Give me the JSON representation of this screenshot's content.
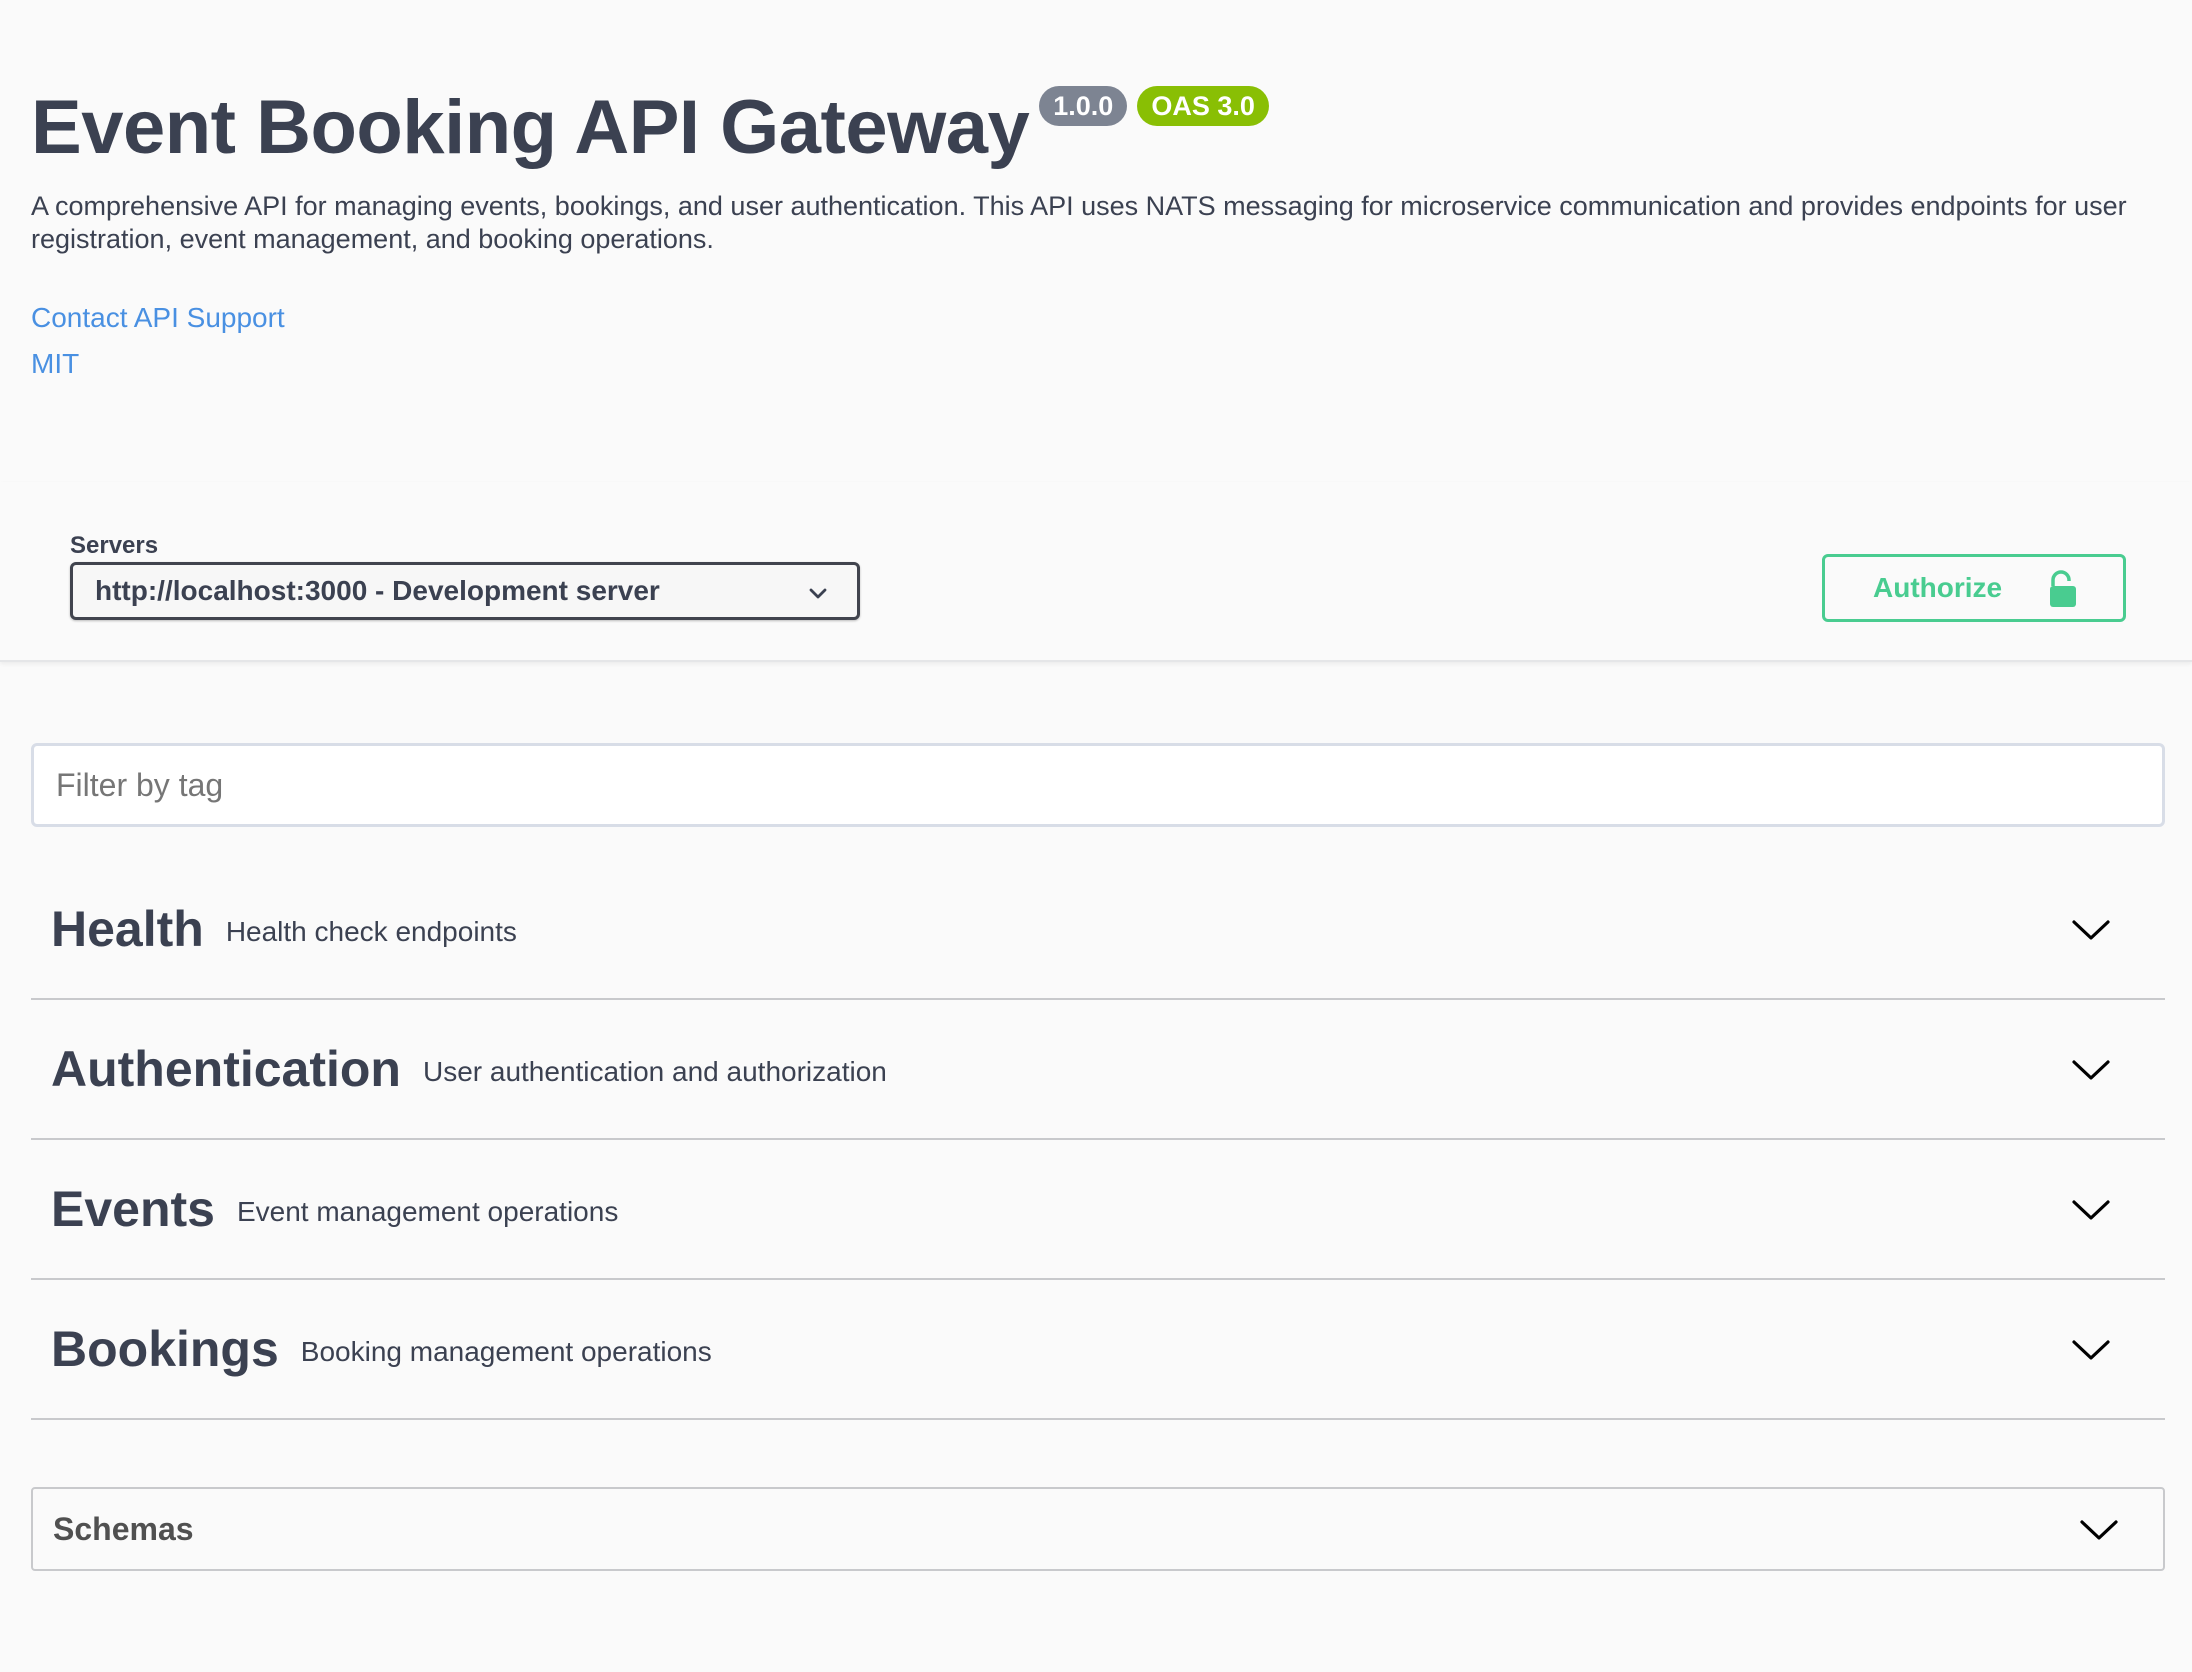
{
  "info": {
    "title": "Event Booking API Gateway",
    "version_badge": "1.0.0",
    "oas_badge": "OAS 3.0",
    "description": "A comprehensive API for managing events, bookings, and user authentication. This API uses NATS messaging for microservice communication and provides endpoints for user registration, event management, and booking operations.",
    "contact_link": "Contact API Support",
    "license_link": "MIT"
  },
  "servers": {
    "label": "Servers",
    "selected": "http://localhost:3000 - Development server"
  },
  "authorize": {
    "label": "Authorize"
  },
  "filter": {
    "placeholder": "Filter by tag",
    "value": ""
  },
  "tags": [
    {
      "name": "Health",
      "description": "Health check endpoints"
    },
    {
      "name": "Authentication",
      "description": "User authentication and authorization"
    },
    {
      "name": "Events",
      "description": "Event management operations"
    },
    {
      "name": "Bookings",
      "description": "Booking management operations"
    }
  ],
  "schemas": {
    "label": "Schemas"
  },
  "colors": {
    "text": "#3b4151",
    "version_badge": "#7d8492",
    "oas_badge": "#89bf04",
    "link": "#4990e2",
    "authorize": "#49cc90",
    "background": "#fafafa"
  },
  "icons": {
    "server_select": "chevron-down-icon",
    "authorize": "unlocked-padlock-icon",
    "tag_expand": "chevron-down-icon"
  }
}
